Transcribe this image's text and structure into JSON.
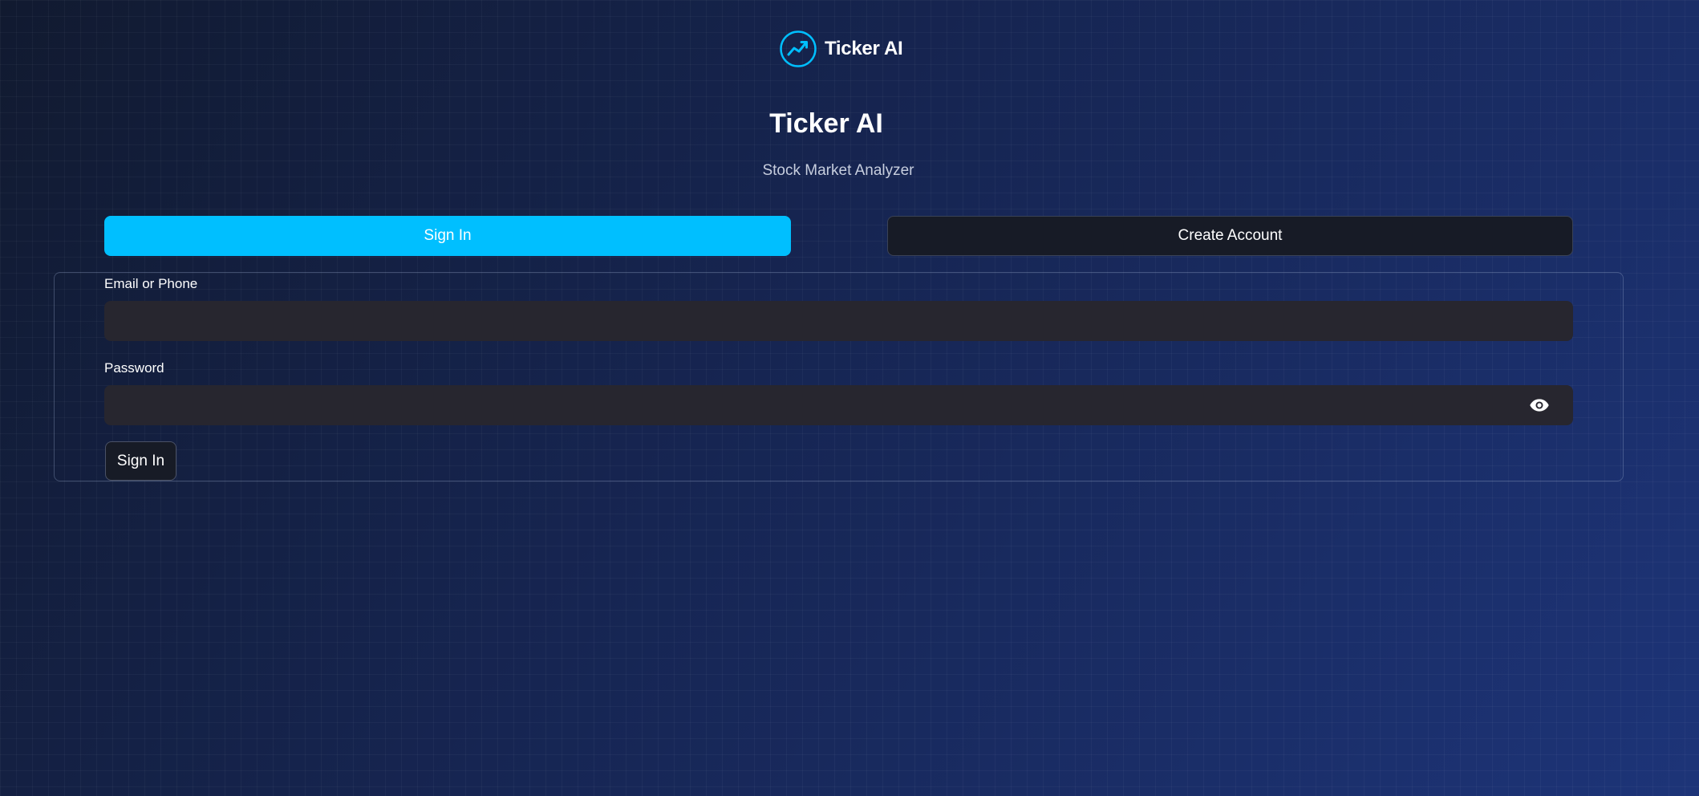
{
  "brand": {
    "name": "Ticker AI",
    "logo_icon": "trend-chart-icon",
    "accent_color": "#00bfff"
  },
  "header": {
    "title": "Ticker AI",
    "subtitle": "Stock Market Analyzer"
  },
  "tabs": [
    {
      "label": "Sign In",
      "active": true
    },
    {
      "label": "Create Account",
      "active": false
    }
  ],
  "form": {
    "email": {
      "label": "Email or Phone",
      "value": "",
      "placeholder": ""
    },
    "password": {
      "label": "Password",
      "value": "",
      "placeholder": "",
      "toggle_icon": "eye-icon"
    },
    "submit_label": "Sign In"
  },
  "colors": {
    "primary": "#00bfff",
    "input_bg": "#27262f",
    "button_dark": "#171b26"
  }
}
